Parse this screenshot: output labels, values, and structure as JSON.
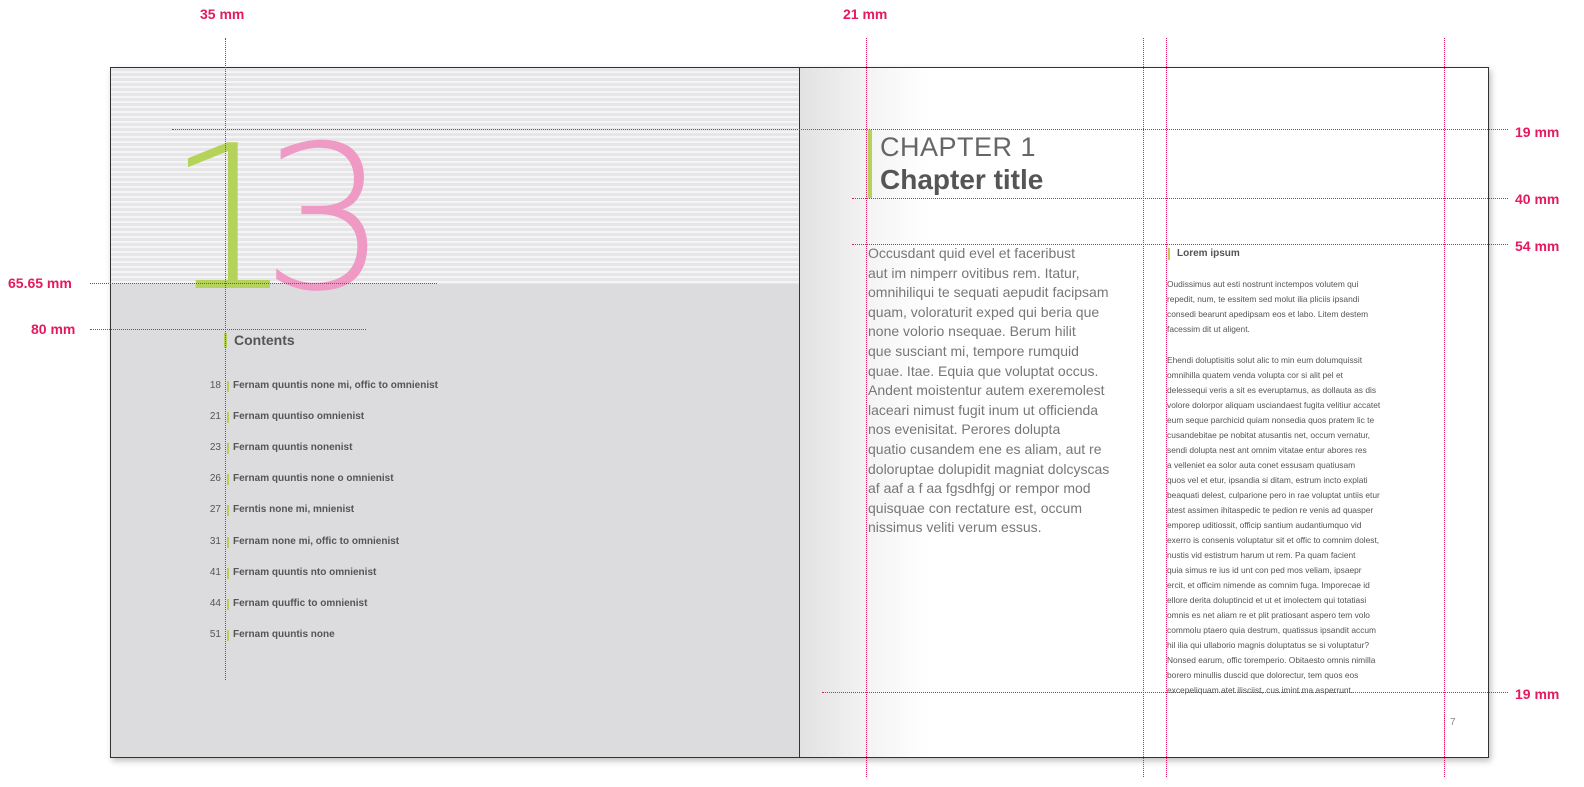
{
  "dimensions": {
    "top_left": "35 mm",
    "top_mid": "21 mm",
    "right_1": "19 mm",
    "right_2": "40 mm",
    "right_3": "54 mm",
    "right_4": "19 mm",
    "left_1": "65.65 mm",
    "left_2": "80 mm"
  },
  "left_page": {
    "chapter_number_digit1": "1",
    "chapter_number_digit2": "3",
    "contents_title": "Contents",
    "toc": [
      {
        "page": "18",
        "title": "Fernam quuntis none mi, offic to omnienist"
      },
      {
        "page": "21",
        "title": "Fernam quuntiso omnienist"
      },
      {
        "page": "23",
        "title": "Fernam quuntis nonenist"
      },
      {
        "page": "26",
        "title": "Fernam quuntis none o omnienist"
      },
      {
        "page": "27",
        "title": "Ferntis none mi, mnienist"
      },
      {
        "page": "31",
        "title": "Fernam none mi, offic to omnienist"
      },
      {
        "page": "41",
        "title": "Fernam quuntis nto omnienist"
      },
      {
        "page": "44",
        "title": "Fernam quuffic to omnienist"
      },
      {
        "page": "51",
        "title": "Fernam quuntis none"
      }
    ]
  },
  "right_page": {
    "chapter_label": "CHAPTER 1",
    "chapter_title": "Chapter title",
    "body_lines": [
      "Occusdant quid evel et faceribust",
      "aut im nimperr ovitibus rem. Itatur,",
      "omnihiliqui te sequati aepudit facipsam",
      "quam, voloraturit exped qui beria que",
      "none volorio nsequae. Berum hilit",
      "que susciant mi, tempore rumquid",
      "quae. Itae. Equia que voluptat occus.",
      "Andent moistentur autem exeremolest",
      "laceari nimust fugit inum ut officienda",
      "nos evenisitat. Perores dolupta",
      "quatio cusandem ene es aliam, aut re",
      "doloruptae dolupidit magniat dolcyscas",
      "af aaf a f aa fgsdhfgj or rempor mod",
      "quisquae con rectature est, occum",
      "nissimus veliti verum essus."
    ],
    "side_heading": "Lorem ipsum",
    "side_para1_lines": [
      "Oudissimus aut esti nostrunt inctempos volutem qui",
      "repedit, num, te essitem sed molut ilia pliciis ipsandi",
      "consedi bearunt apedipsam eos et labo. Litem destem",
      "facessim dit ut aligent."
    ],
    "side_para2_lines": [
      "Ehendi doluptisitis solut alic to min eum dolumquissit",
      "omnihilla quatem venda volupta cor si alit pel et",
      "delessequi veris a sit es everuptamus, as dollauta as dis",
      "volore dolorpor aliquam usciandaest fugita velitiur accatet",
      "eum seque parchicid quiam nonsedia quos pratem lic te",
      "cusandebitae pe nobitat atusantis net, occum vernatur,",
      "sendi dolupta nest ant omnim vitatae entur abores res",
      "a velleniet ea solor auta conet essusam quatiusam",
      "quos vel et etur, ipsandia si ditam, estrum incto explati",
      "beaquati delest, culparione pero in rae voluptat untiis etur",
      "atest assimen ihitaspedic te pedion re venis ad quasper",
      "emporep uditiossit, officip santium audantiumquo vid",
      "exerro is consenis voluptatur sit et offic to comnim dolest,",
      "nustis vid estistrum harum ut rem. Pa quam facient",
      "quia simus re ius id unt con ped mos veliam, ipsaepr",
      "ercit, et officim nimende as comnim fuga. Imporecae id",
      "ellore derita doluptincid et ut et imolectem qui totatiasi",
      "omnis es net aliam re et plit pratiosant aspero tem volo",
      "commolu ptaero quia destrum, quatissus ipsandit accum",
      "hil ilia qui ullaborio magnis doluptatus se si voluptatur?",
      "Nonsed earum, offic toremperio. Obitaesto omnis nimilla",
      "borero minullis duscid que dolorectur, tem quos eos",
      "excepeliquam atet ilisciist, cus imint ma asperrunt."
    ],
    "page_number": "7"
  },
  "colors": {
    "guide": "#e5195f",
    "green": "#b5d35a",
    "pink": "#ee9ac5",
    "left_page_bg": "#dcdcde"
  }
}
